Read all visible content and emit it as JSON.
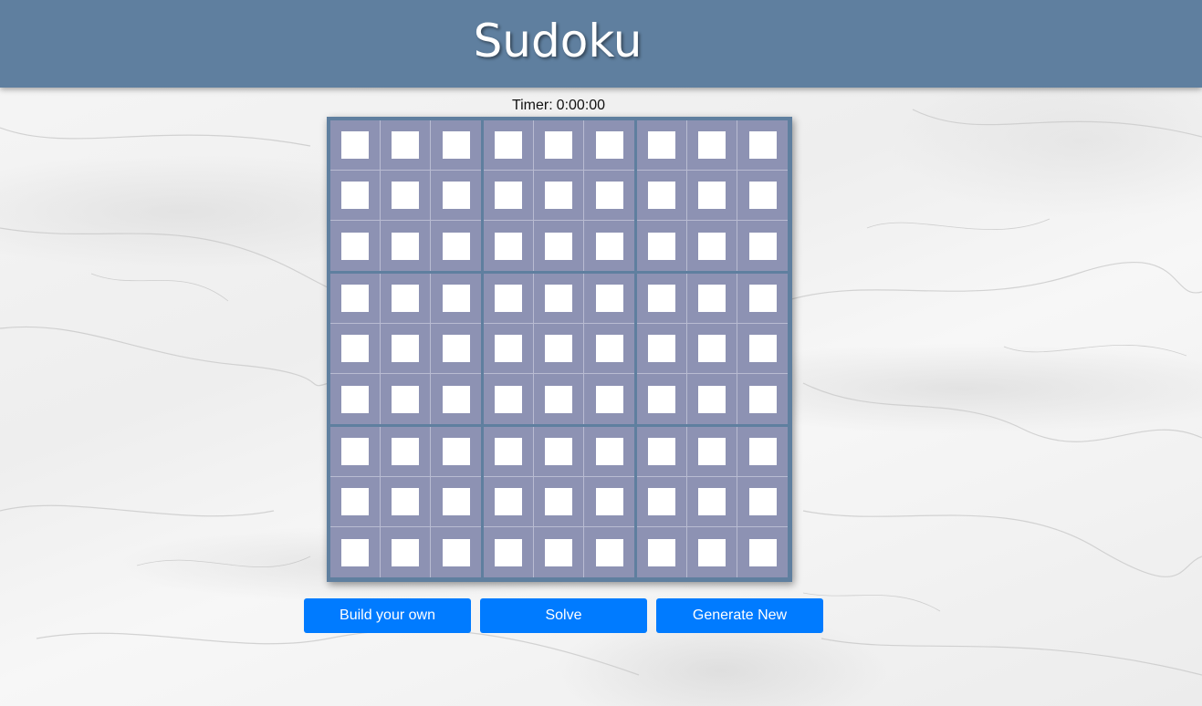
{
  "header": {
    "title": "Sudoku"
  },
  "timer": {
    "label": "Timer:",
    "value": "0:00:00"
  },
  "board": {
    "cells": [
      [
        "",
        "",
        "",
        "",
        "",
        "",
        "",
        "",
        ""
      ],
      [
        "",
        "",
        "",
        "",
        "",
        "",
        "",
        "",
        ""
      ],
      [
        "",
        "",
        "",
        "",
        "",
        "",
        "",
        "",
        ""
      ],
      [
        "",
        "",
        "",
        "",
        "",
        "",
        "",
        "",
        ""
      ],
      [
        "",
        "",
        "",
        "",
        "",
        "",
        "",
        "",
        ""
      ],
      [
        "",
        "",
        "",
        "",
        "",
        "",
        "",
        "",
        ""
      ],
      [
        "",
        "",
        "",
        "",
        "",
        "",
        "",
        "",
        ""
      ],
      [
        "",
        "",
        "",
        "",
        "",
        "",
        "",
        "",
        ""
      ],
      [
        "",
        "",
        "",
        "",
        "",
        "",
        "",
        "",
        ""
      ]
    ]
  },
  "actions": {
    "build_label": "Build your own",
    "solve_label": "Solve",
    "generate_label": "Generate New"
  },
  "colors": {
    "header_bg": "#5f7f9f",
    "board_border": "#5f7f9f",
    "cell_bg": "#8d92b3",
    "input_bg": "#ffffff",
    "button_bg": "#007bff",
    "button_text": "#ffffff"
  }
}
